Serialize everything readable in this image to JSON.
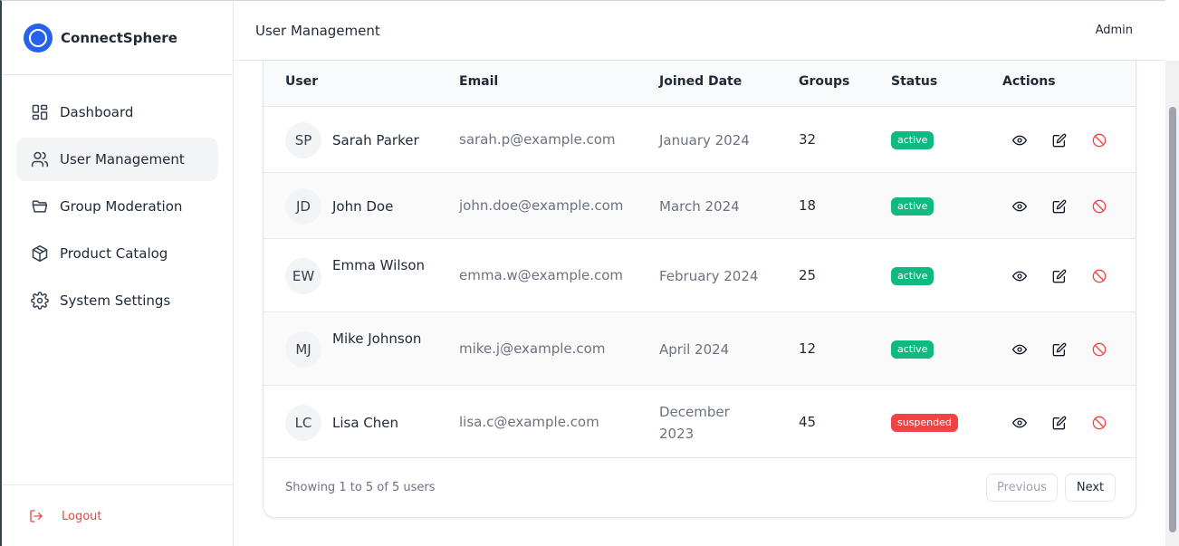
{
  "app": {
    "name": "ConnectSphere"
  },
  "sidebar": {
    "items": [
      {
        "label": "Dashboard",
        "icon": "dashboard-icon",
        "active": false
      },
      {
        "label": "User Management",
        "icon": "users-icon",
        "active": true
      },
      {
        "label": "Group Moderation",
        "icon": "folder-icon",
        "active": false
      },
      {
        "label": "Product Catalog",
        "icon": "package-icon",
        "active": false
      },
      {
        "label": "System Settings",
        "icon": "gear-icon",
        "active": false
      }
    ],
    "logout_label": "Logout"
  },
  "header": {
    "title": "User Management",
    "user": "Admin"
  },
  "table": {
    "columns": [
      "User",
      "Email",
      "Joined Date",
      "Groups",
      "Status",
      "Actions"
    ],
    "rows": [
      {
        "initials": "SP",
        "name": "Sarah Parker",
        "email": "sarah.p@example.com",
        "joined": "January 2024",
        "groups": "32",
        "status": "active"
      },
      {
        "initials": "JD",
        "name": "John Doe",
        "email": "john.doe@example.com",
        "joined": "March 2024",
        "groups": "18",
        "status": "active"
      },
      {
        "initials": "EW",
        "name": "Emma Wilson",
        "email": "emma.w@example.com",
        "joined": "February 2024",
        "groups": "25",
        "status": "active"
      },
      {
        "initials": "MJ",
        "name": "Mike Johnson",
        "email": "mike.j@example.com",
        "joined": "April 2024",
        "groups": "12",
        "status": "active"
      },
      {
        "initials": "LC",
        "name": "Lisa Chen",
        "email": "lisa.c@example.com",
        "joined": "December 2023",
        "groups": "45",
        "status": "suspended"
      }
    ]
  },
  "pagination": {
    "summary": "Showing 1 to 5 of 5 users",
    "prev_label": "Previous",
    "next_label": "Next"
  },
  "colors": {
    "brand": "#2563eb",
    "active": "#10b981",
    "suspended": "#ef4444",
    "danger": "#ef4444"
  }
}
